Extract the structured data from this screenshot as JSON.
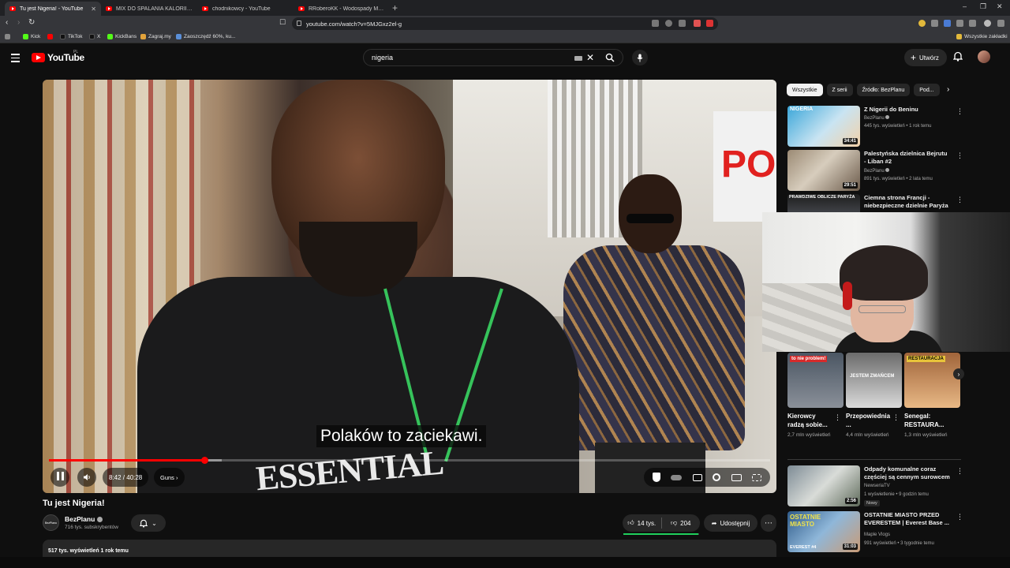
{
  "browser": {
    "tabs": [
      {
        "title": "Tu jest Nigeria! - YouTube",
        "active": true
      },
      {
        "title": "MIX DO SPALANIA KALORII NA SIŁOWNI - YouTube",
        "active": false
      },
      {
        "title": "chodnikowcy - YouTube",
        "active": false
      },
      {
        "title": "RRoberoKK - Wodospady Meliniary | Kick",
        "active": false
      }
    ],
    "new_tab": "+",
    "url": "youtube.com/watch?v=5MJGxz2el-g",
    "bookmarks": [
      "Kick",
      "TikTok",
      "X",
      "KickBans",
      "Zagraj.my",
      "Zaoszczędź 60%, ku..."
    ],
    "all_bookmarks_label": "Wszystkie zakładki",
    "colors": {
      "chrome_dark": "#202124",
      "chrome_mid": "#35363a"
    }
  },
  "youtube": {
    "logo_text": "YouTube",
    "country_code": "PL",
    "search_query": "nigeria",
    "create_label": "Utwórz",
    "accent": "#ff0000"
  },
  "player": {
    "subtitle": "Polaków to zaciekawi.",
    "time": "8:42 / 40:28",
    "chapter": "Guns",
    "progress": 0.215,
    "buffered": 0.24,
    "sign_text": "PO"
  },
  "video": {
    "title": "Tu jest Nigeria!",
    "channel": "BezPlanu",
    "channel_avatar_text": "BezPlanu",
    "subscribers": "716 tys. subskrybentów",
    "likes": "14 tys.",
    "dislikes": "204",
    "share_label": "Udostępnij",
    "description_preview": "517 tys. wyświetleń  1 rok temu",
    "like_ratio": 0.986
  },
  "sidebar": {
    "chips": [
      "Wszystkie",
      "Z serii",
      "Źródło: BezPlanu",
      "Pod..."
    ],
    "recommendations_top": [
      {
        "title": "Z Nigerii do Beninu",
        "channel": "BezPlanu",
        "verified": true,
        "meta": "445 tys. wyświetleń • 1 rok temu",
        "duration": "34:41",
        "thumb_text": "NIGERIA"
      },
      {
        "title": "Palestyńska dzielnica Bejrutu - Liban #2",
        "channel": "BezPlanu",
        "verified": true,
        "meta": "891 tys. wyświetleń • 2 lata temu",
        "duration": "29:51"
      },
      {
        "title": "Ciemna strona Francji - niebezpieczne dzielnie Paryża",
        "channel": "",
        "meta": "",
        "duration": "",
        "thumb_text": "PRAWDZIWE OBLICZE PARYŻA"
      }
    ],
    "shorts": [
      {
        "title": "Kierowcy radzą sobie...",
        "views": "2,7 mln wyświetleń",
        "overlay": "to nie problem!"
      },
      {
        "title": "Przepowiednia ...",
        "views": "4,4 mln wyświetleń",
        "overlay": "JESTEM ZMAŃCEM"
      },
      {
        "title": "Senegal: RESTAURA...",
        "views": "1,3 mln wyświetleń",
        "overlay": "RESTAURACJA"
      }
    ],
    "recommendations_bottom": [
      {
        "title": "Odpady komunalne coraz częściej są cennym surowcem",
        "channel": "NewseriaTV",
        "meta": "1 wyświetlenie • 9 godzin temu",
        "duration": "2:56",
        "badge": "Nowy"
      },
      {
        "title": "OSTATNIE MIASTO PRZED EVERESTEM | Everest Base ...",
        "channel": "Maple Vlogs",
        "meta": "991 wyświetleń • 3 tygodnie temu",
        "duration": "31:03",
        "thumb_text": "OSTATNIE MIASTO",
        "thumb_sub": "EVEREST #4"
      }
    ]
  }
}
